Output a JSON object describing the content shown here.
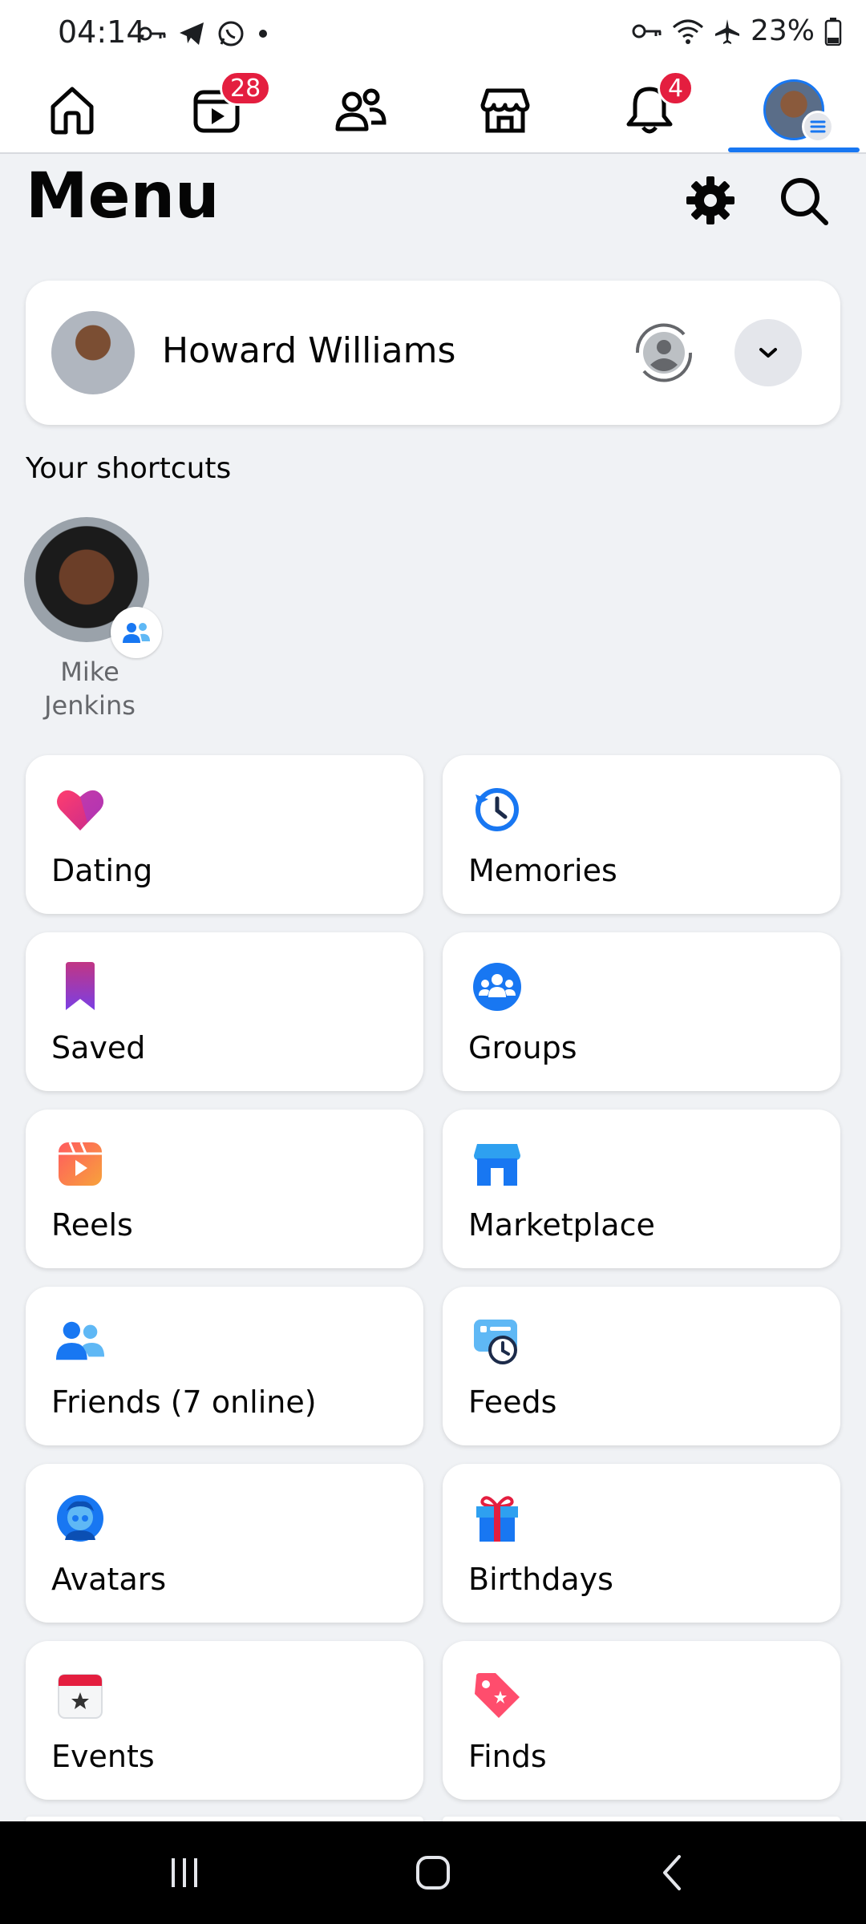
{
  "status_bar": {
    "time": "04:14",
    "battery": "23%",
    "left_icons": [
      "key-icon",
      "telegram-icon",
      "whatsapp-icon",
      "dot-icon"
    ],
    "right_icons": [
      "key-icon",
      "wifi-icon",
      "airplane-icon",
      "battery-icon"
    ]
  },
  "nav": {
    "items": [
      {
        "name": "home",
        "icon": "home-icon",
        "badge": ""
      },
      {
        "name": "video",
        "icon": "video-icon",
        "badge": "28"
      },
      {
        "name": "friends",
        "icon": "friends-icon",
        "badge": ""
      },
      {
        "name": "marketplace",
        "icon": "store-icon",
        "badge": ""
      },
      {
        "name": "notifications",
        "icon": "bell-icon",
        "badge": "4"
      },
      {
        "name": "menu",
        "icon": "avatar",
        "badge": ""
      }
    ],
    "active": "menu",
    "accent": "#1877f2",
    "badge_color": "#e41e3f"
  },
  "header": {
    "title": "Menu",
    "settings_icon": "gear-icon",
    "search_icon": "search-icon"
  },
  "profile": {
    "name": "Howard Williams"
  },
  "shortcuts": {
    "title": "Your shortcuts",
    "items": [
      {
        "label": "Mike Jenkins"
      }
    ]
  },
  "tiles": [
    {
      "label": "Dating",
      "icon": "heart-icon"
    },
    {
      "label": "Memories",
      "icon": "clock-icon"
    },
    {
      "label": "Saved",
      "icon": "bookmark-icon"
    },
    {
      "label": "Groups",
      "icon": "groups-icon"
    },
    {
      "label": "Reels",
      "icon": "reels-icon"
    },
    {
      "label": "Marketplace",
      "icon": "store-icon"
    },
    {
      "label": "Friends (7 online)",
      "icon": "friends-icon"
    },
    {
      "label": "Feeds",
      "icon": "feeds-icon"
    },
    {
      "label": "Avatars",
      "icon": "avatar-icon"
    },
    {
      "label": "Birthdays",
      "icon": "gift-icon"
    },
    {
      "label": "Events",
      "icon": "calendar-icon"
    },
    {
      "label": "Finds",
      "icon": "tag-icon"
    }
  ]
}
